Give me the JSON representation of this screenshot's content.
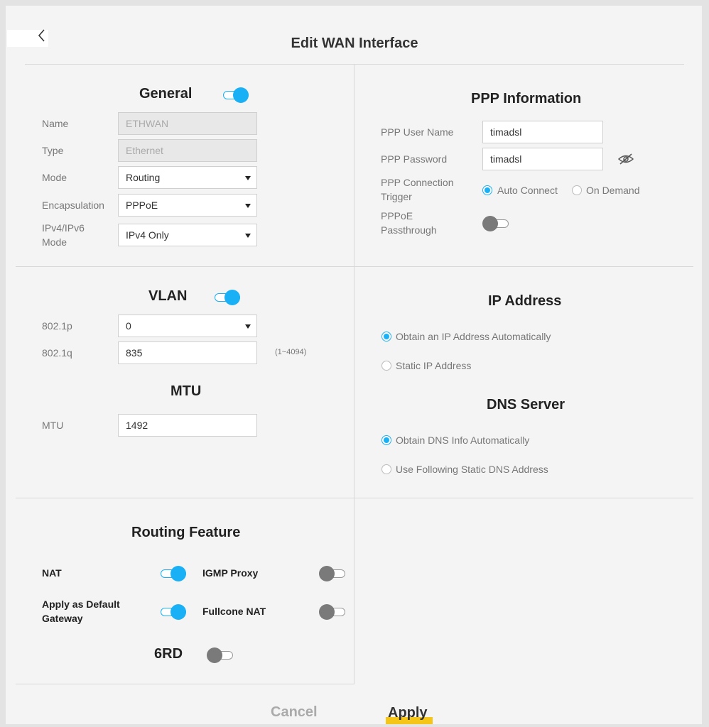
{
  "page": {
    "title": "Edit WAN Interface"
  },
  "general": {
    "title": "General",
    "enabled": true,
    "name": {
      "label": "Name",
      "value": "ETHWAN"
    },
    "type": {
      "label": "Type",
      "value": "Ethernet"
    },
    "mode": {
      "label": "Mode",
      "value": "Routing"
    },
    "encapsulation": {
      "label": "Encapsulation",
      "value": "PPPoE"
    },
    "ip_mode": {
      "label_line1": "IPv4/IPv6",
      "label_line2": "Mode",
      "value": "IPv4 Only"
    }
  },
  "ppp": {
    "title": "PPP Information",
    "user_name": {
      "label": "PPP User Name",
      "value": "timadsl"
    },
    "password": {
      "label": "PPP Password",
      "value": "timadsl"
    },
    "trigger": {
      "label_line1": "PPP Connection",
      "label_line2": "Trigger",
      "options": [
        "Auto Connect",
        "On Demand"
      ],
      "selected": "Auto Connect"
    },
    "passthrough": {
      "label_line1": "PPPoE",
      "label_line2": "Passthrough",
      "enabled": false
    }
  },
  "vlan": {
    "title": "VLAN",
    "enabled": true,
    "p8021p": {
      "label": "802.1p",
      "value": "0"
    },
    "q8021q": {
      "label": "802.1q",
      "value": "835",
      "hint": "(1~4094)"
    }
  },
  "mtu": {
    "title": "MTU",
    "label": "MTU",
    "value": "1492"
  },
  "ip_address": {
    "title": "IP Address",
    "options": [
      "Obtain an IP Address Automatically",
      "Static IP Address"
    ],
    "selected": "Obtain an IP Address Automatically"
  },
  "dns": {
    "title": "DNS Server",
    "options": [
      "Obtain DNS Info Automatically",
      "Use Following Static DNS Address"
    ],
    "selected": "Obtain DNS Info Automatically"
  },
  "routing": {
    "title": "Routing Feature",
    "nat": {
      "label": "NAT",
      "enabled": true
    },
    "igmp": {
      "label": "IGMP Proxy",
      "enabled": false
    },
    "default_gw": {
      "label_line1": "Apply as Default",
      "label_line2": "Gateway",
      "enabled": true
    },
    "fullcone": {
      "label": "Fullcone NAT",
      "enabled": false
    },
    "sixrd": {
      "label": "6RD",
      "enabled": false
    }
  },
  "actions": {
    "cancel": "Cancel",
    "apply": "Apply"
  },
  "colors": {
    "accent": "#1ab0f5",
    "apply_highlight": "#f5c518",
    "toggle_off": "#7a7a7a"
  }
}
